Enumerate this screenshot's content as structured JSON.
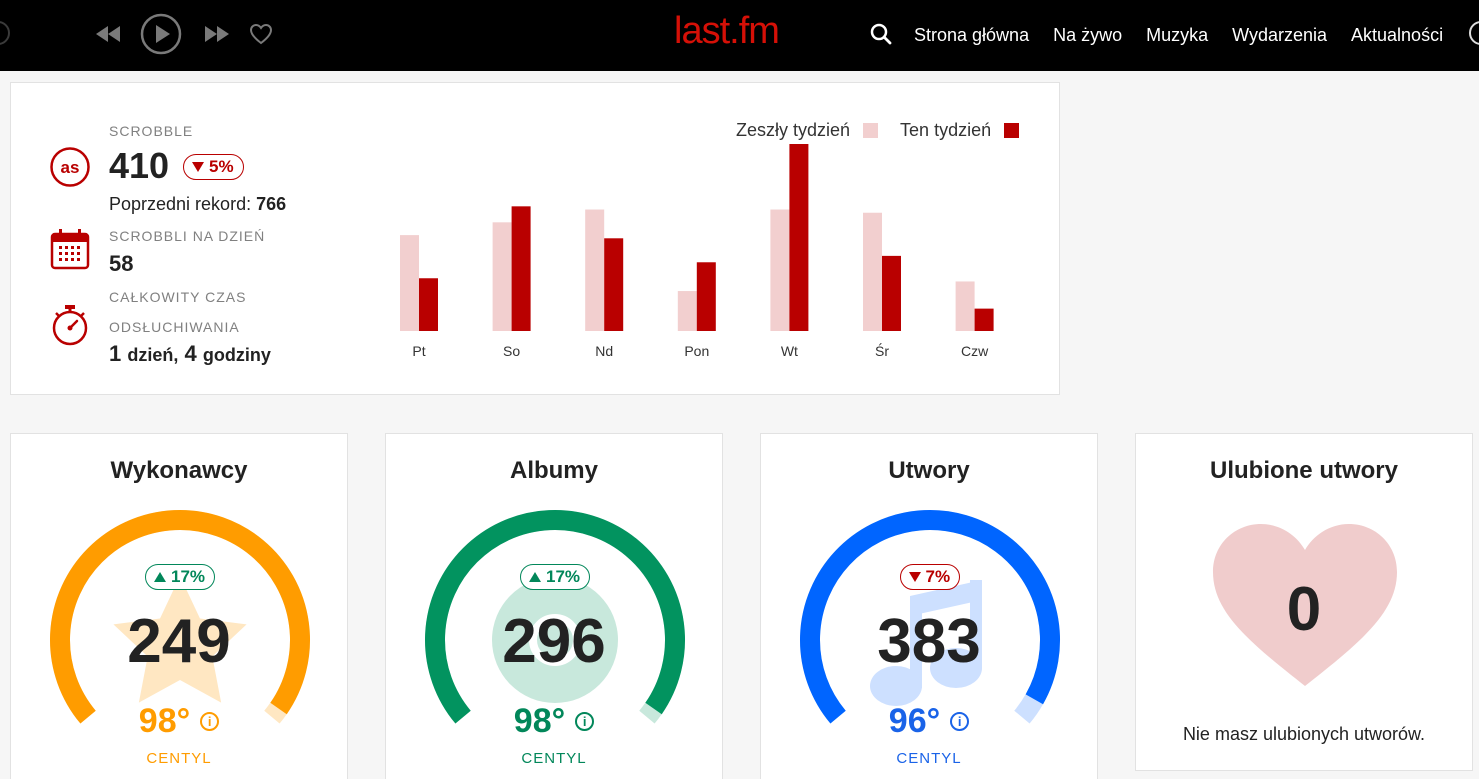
{
  "nav": {
    "logo": "last.fm",
    "links": [
      "Strona główna",
      "Na żywo",
      "Muzyka",
      "Wydarzenia",
      "Aktualności"
    ]
  },
  "summary": {
    "scrobble_label": "SCROBBLE",
    "scrobble_value": "410",
    "scrobble_change": "5%",
    "record_label": "Poprzedni rekord:",
    "record_value": "766",
    "per_day_label": "SCROBBLI NA DZIEŃ",
    "per_day_value": "58",
    "time_label_1": "CAŁKOWITY CZAS",
    "time_label_2": "ODSŁUCHIWANIA",
    "time_days_num": "1",
    "time_days_unit": "dzień,",
    "time_hours_num": "4",
    "time_hours_unit": "godziny"
  },
  "chart_data": {
    "type": "bar",
    "categories": [
      "Pt",
      "So",
      "Nd",
      "Pon",
      "Wt",
      "Śr",
      "Czw"
    ],
    "series": [
      {
        "name": "Zeszły tydzień",
        "values": [
          60,
          68,
          76,
          25,
          76,
          74,
          31
        ],
        "color": "#f2cfcf"
      },
      {
        "name": "Ten tydzień",
        "values": [
          33,
          78,
          58,
          43,
          117,
          47,
          14
        ],
        "color": "#b90000"
      }
    ],
    "ylim": [
      0,
      120
    ],
    "legend": "top-right"
  },
  "stats": [
    {
      "title": "Wykonawcy",
      "value": "249",
      "change": "17%",
      "direction": "up",
      "percentile": "98°",
      "percentile_fraction": 0.98,
      "percentile_label": "CENTYL",
      "color": "#ff9c00",
      "light": "#ffe7c2",
      "text_color": "#ff9c00",
      "icon": "star-icon"
    },
    {
      "title": "Albumy",
      "value": "296",
      "change": "17%",
      "direction": "up",
      "percentile": "98°",
      "percentile_fraction": 0.98,
      "percentile_label": "CENTYL",
      "color": "#02935f",
      "light": "#c8e8dc",
      "text_color": "#02875a",
      "icon": "disc-icon"
    },
    {
      "title": "Utwory",
      "value": "383",
      "change": "7%",
      "direction": "down",
      "percentile": "96°",
      "percentile_fraction": 0.96,
      "percentile_label": "CENTYL",
      "color": "#0065ff",
      "light": "#cde0ff",
      "text_color": "#1a63e8",
      "icon": "music-note-icon"
    }
  ],
  "favorites": {
    "title": "Ulubione utwory",
    "value": "0",
    "empty_text": "Nie masz ulubionych utworów.",
    "color": "#f0cccc",
    "icon": "heart-icon"
  }
}
